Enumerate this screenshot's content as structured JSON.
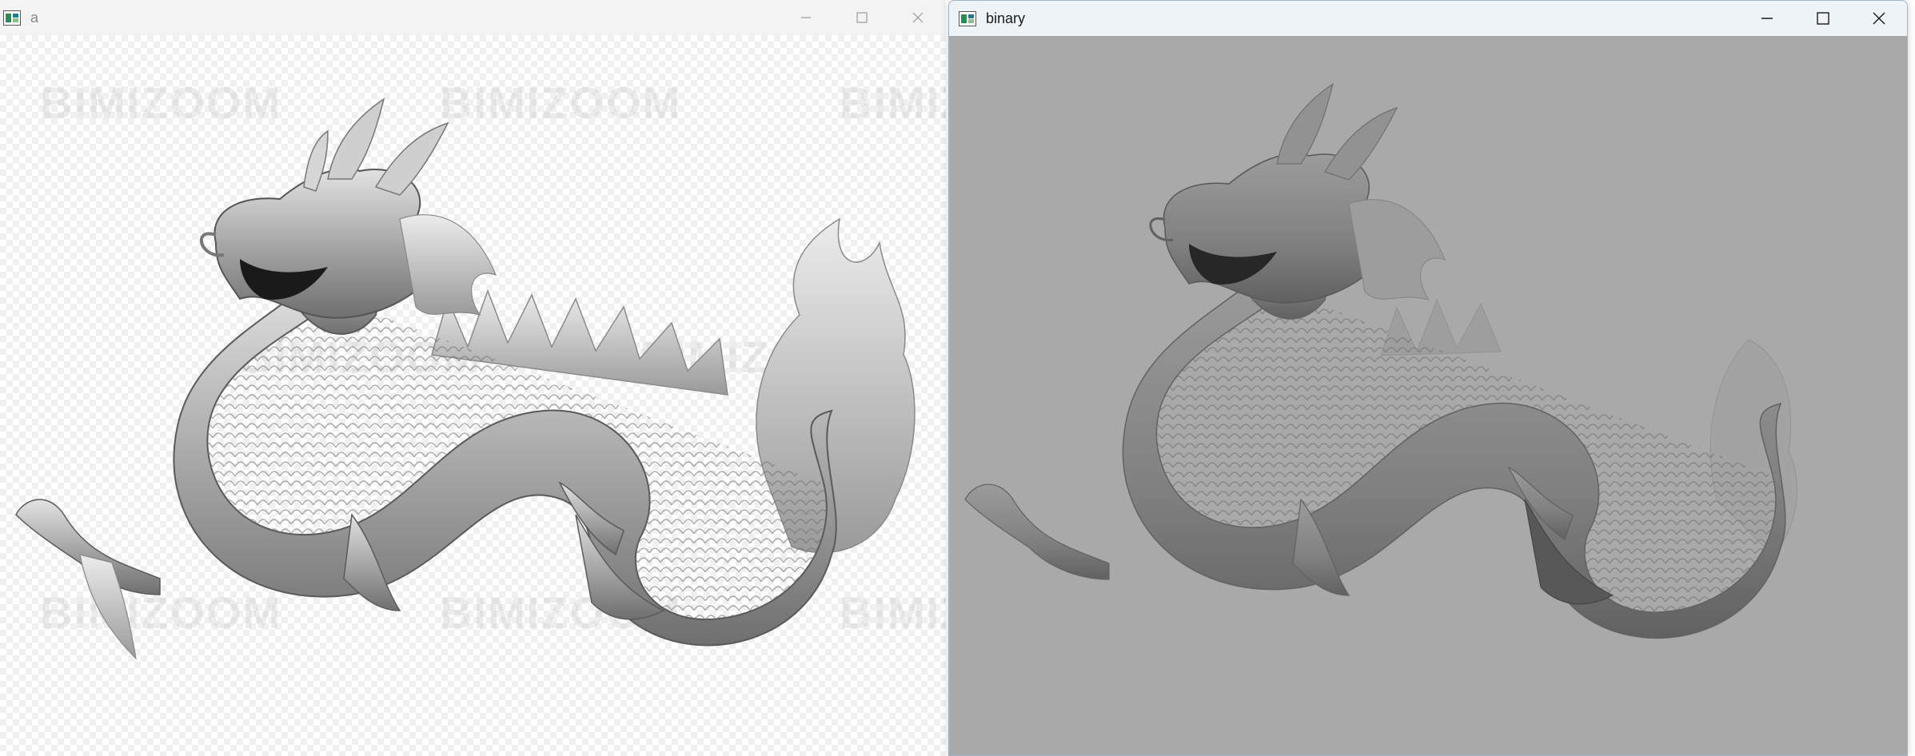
{
  "windows": {
    "a": {
      "title": "a",
      "watermark": "BIMIZOOM"
    },
    "binary": {
      "title": "binary"
    }
  },
  "controls": {
    "minimize_icon": "minimize-icon",
    "maximize_icon": "maximize-icon",
    "close_icon": "close-icon"
  },
  "colors": {
    "binary_background": "#a9a9a9",
    "app_icon_green": "#2e8b57",
    "app_icon_teal": "#1f7a8c"
  }
}
